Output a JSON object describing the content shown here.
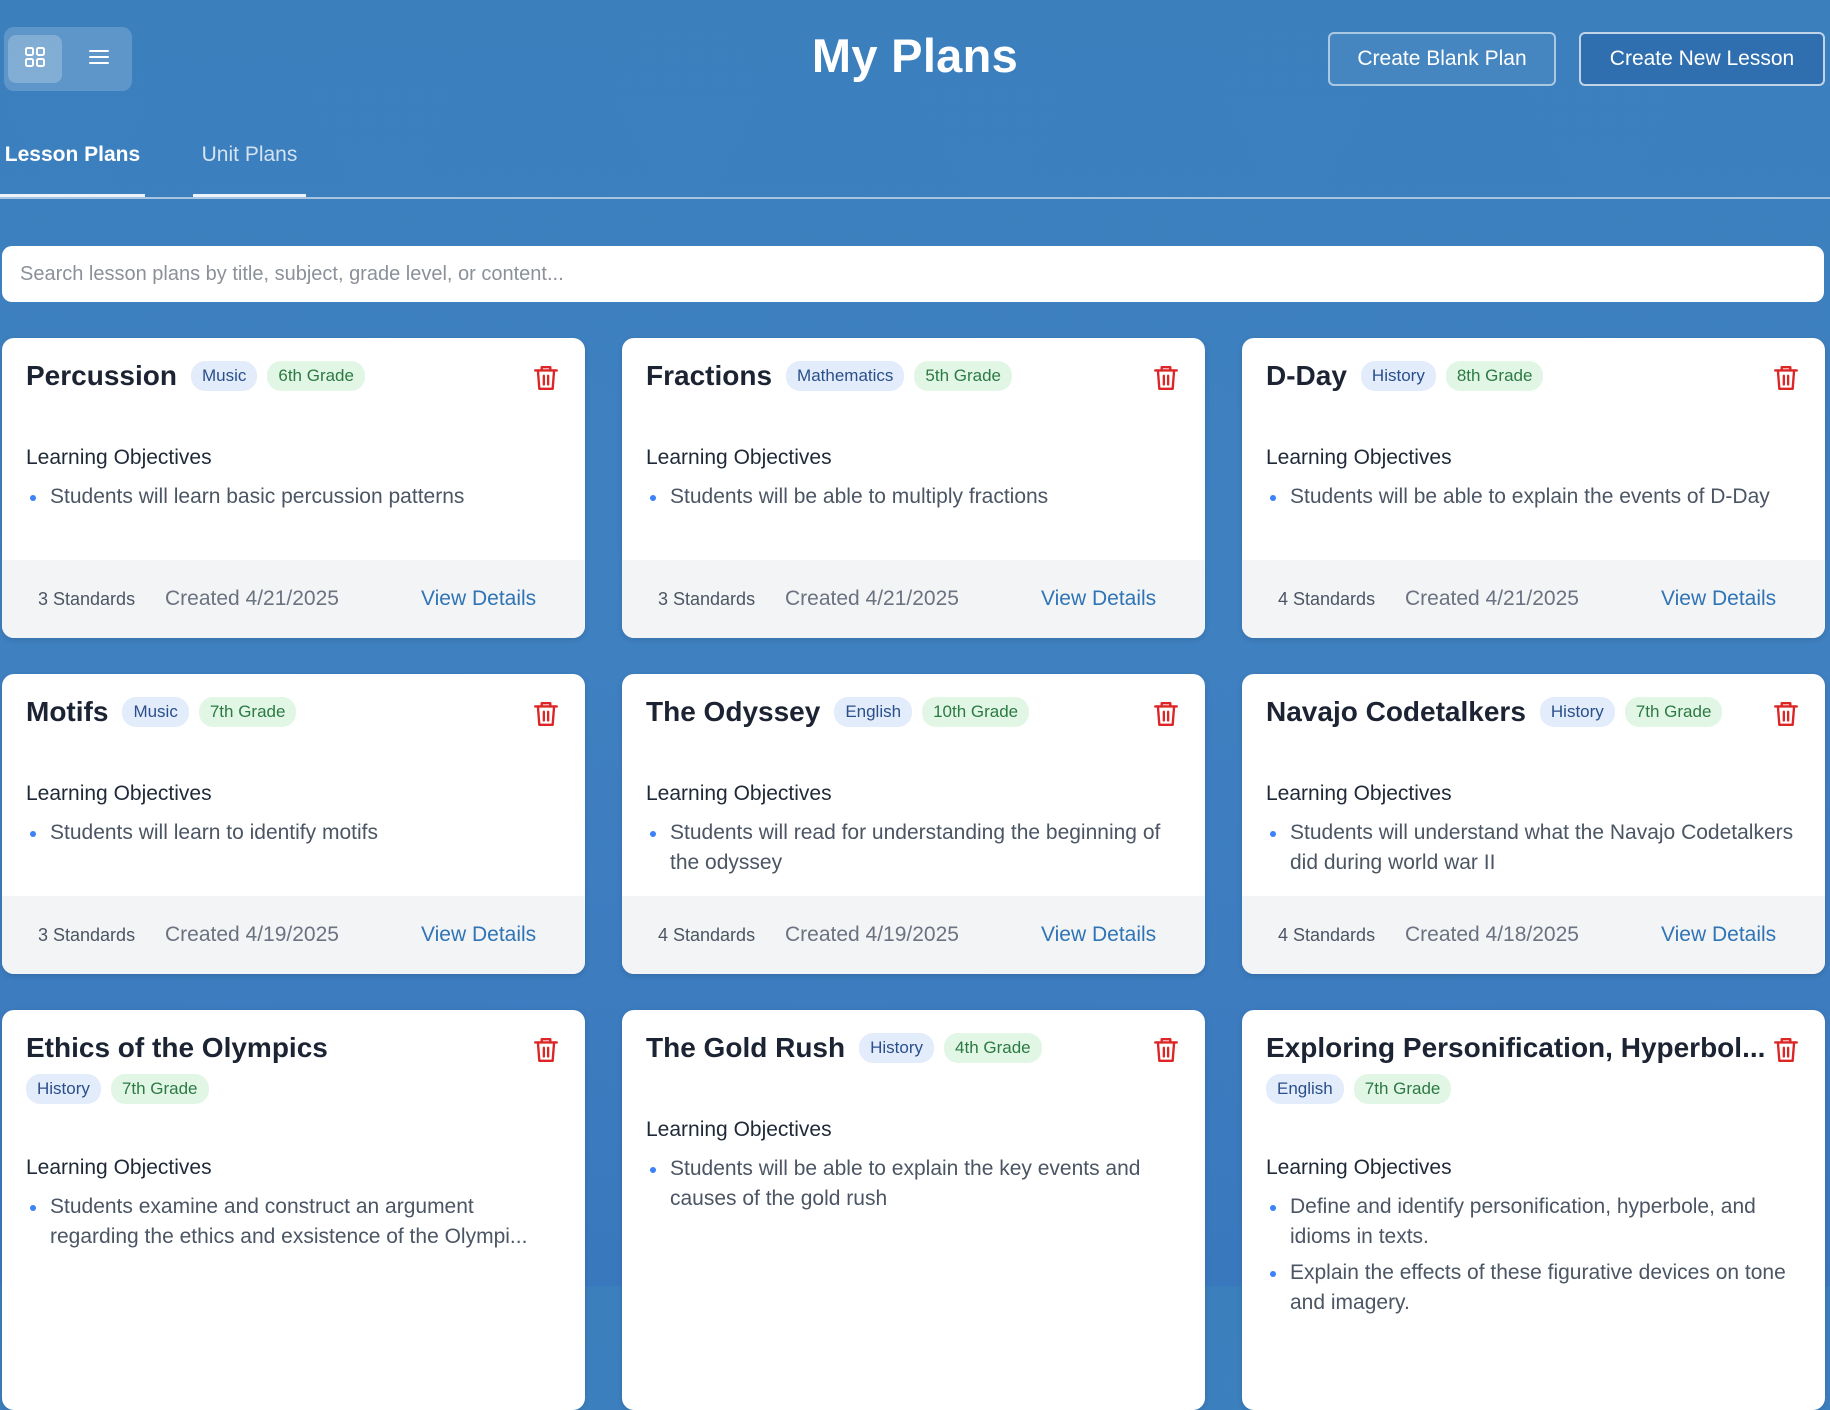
{
  "header": {
    "title": "My Plans",
    "create_blank_label": "Create Blank Plan",
    "create_new_label": "Create New Lesson"
  },
  "tabs": [
    {
      "label": "Lesson Plans",
      "active": true
    },
    {
      "label": "Unit Plans",
      "active": false
    }
  ],
  "search": {
    "placeholder": "Search lesson plans by title, subject, grade level, or content...",
    "value": ""
  },
  "objectives_heading": "Learning Objectives",
  "view_details_label": "View Details",
  "colors": {
    "subject_badge_bg": "#e3ecfb",
    "grade_badge_bg": "#e2f6e6",
    "trash": "#dc2626",
    "link": "#2f74b5"
  },
  "cards": [
    {
      "title": "Percussion",
      "subject": "Music",
      "grade": "6th Grade",
      "objectives": [
        "Students will learn basic percussion patterns"
      ],
      "standards": "3 Standards",
      "created": "Created 4/21/2025"
    },
    {
      "title": "Fractions",
      "subject": "Mathematics",
      "grade": "5th Grade",
      "objectives": [
        "Students will be able to multiply fractions"
      ],
      "standards": "3 Standards",
      "created": "Created 4/21/2025"
    },
    {
      "title": "D-Day",
      "subject": "History",
      "grade": "8th Grade",
      "objectives": [
        "Students will be able to explain the events of D-Day"
      ],
      "standards": "4 Standards",
      "created": "Created 4/21/2025"
    },
    {
      "title": "Motifs",
      "subject": "Music",
      "grade": "7th Grade",
      "objectives": [
        "Students will learn to identify motifs"
      ],
      "standards": "3 Standards",
      "created": "Created 4/19/2025"
    },
    {
      "title": "The Odyssey",
      "subject": "English",
      "grade": "10th Grade",
      "objectives": [
        "Students will read for understanding the beginning of the odyssey"
      ],
      "standards": "4 Standards",
      "created": "Created 4/19/2025"
    },
    {
      "title": "Navajo Codetalkers",
      "subject": "History",
      "grade": "7th Grade",
      "objectives": [
        "Students will understand what the Navajo Codetalkers did during world war II"
      ],
      "standards": "4 Standards",
      "created": "Created 4/18/2025"
    },
    {
      "title": "Ethics of the Olympics",
      "subject": "History",
      "grade": "7th Grade",
      "objectives": [
        "Students examine and construct an argument regarding the ethics and exsistence of the Olympi..."
      ],
      "standards": "",
      "created": ""
    },
    {
      "title": "The Gold Rush",
      "subject": "History",
      "grade": "4th Grade",
      "objectives": [
        "Students will be able to explain the key events and causes of the gold rush"
      ],
      "standards": "",
      "created": ""
    },
    {
      "title": "Exploring Personification, Hyperbol...",
      "subject": "English",
      "grade": "7th Grade",
      "objectives": [
        "Define and identify personification, hyperbole, and idioms in texts.",
        "Explain the effects of these figurative devices on tone and imagery."
      ],
      "standards": "",
      "created": ""
    }
  ]
}
